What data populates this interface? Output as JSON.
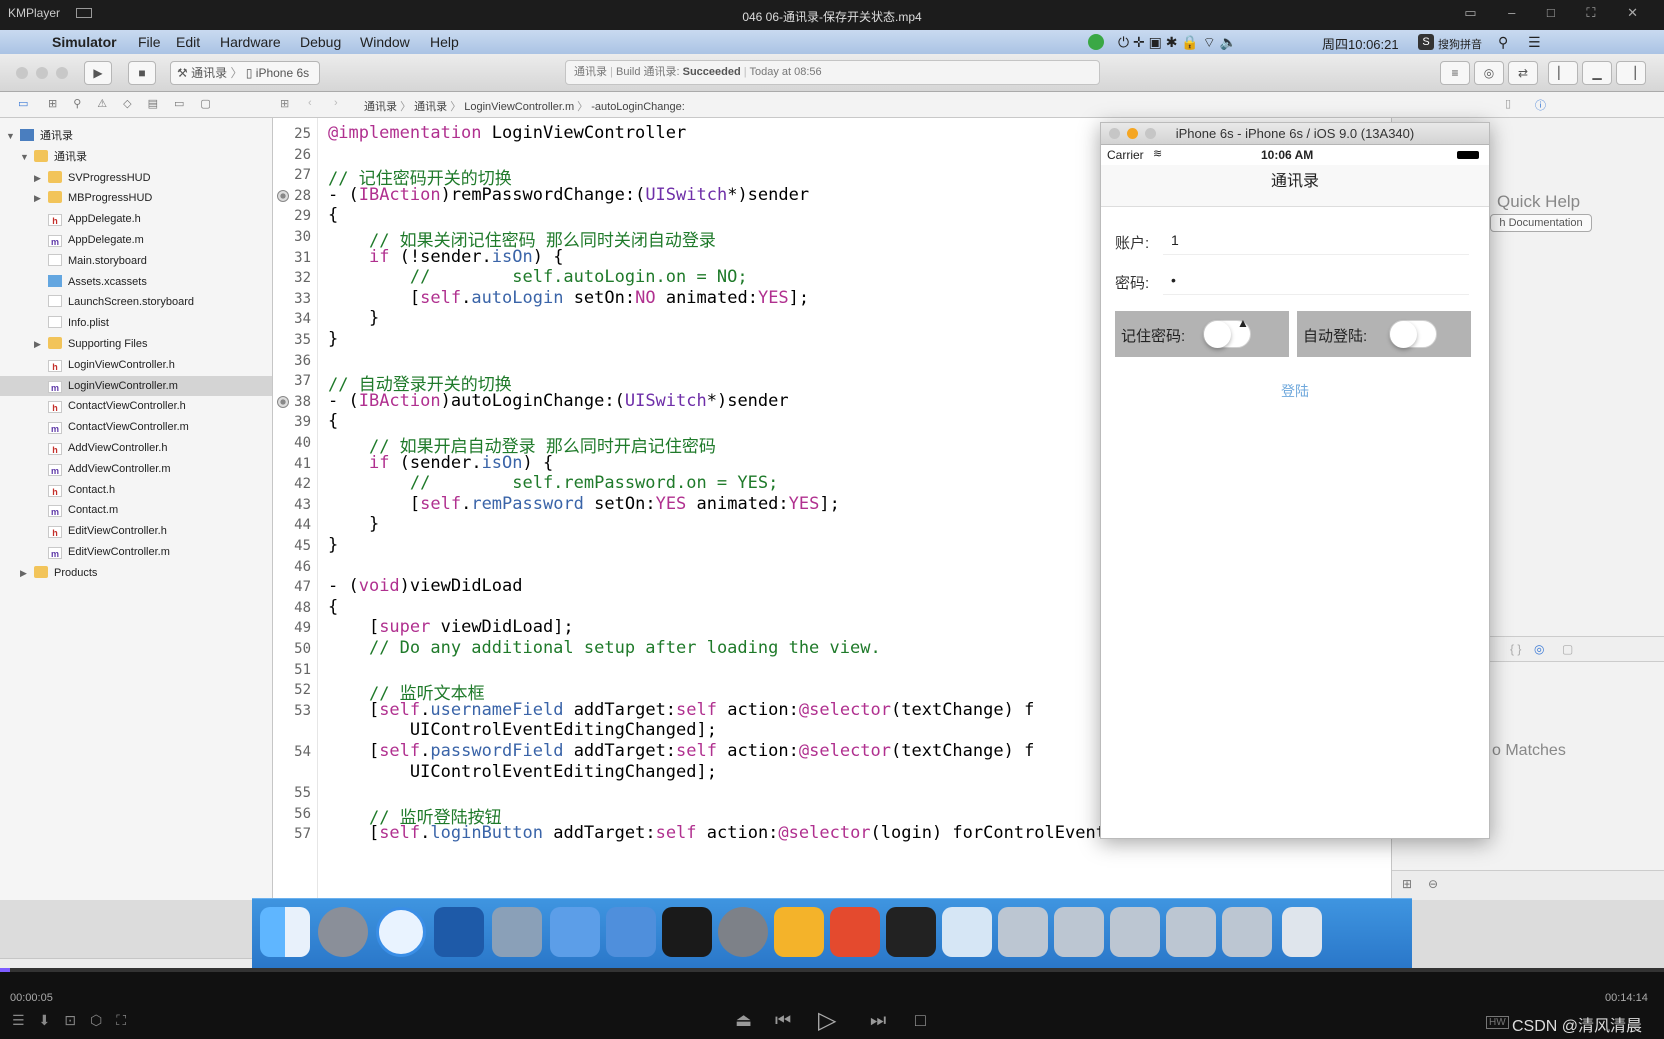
{
  "player": {
    "app_name": "KMPlayer",
    "file_title": "046 06-通讯录-保存开关状态.mp4",
    "time_current": "00:00:05",
    "time_total": "00:14:14",
    "progress": 0.006,
    "watermark": "CSDN @清风清晨"
  },
  "menubar": {
    "app": "Simulator",
    "items": [
      "File",
      "Edit",
      "Hardware",
      "Debug",
      "Window",
      "Help"
    ],
    "clock": "周四10:06:21",
    "input_method": "搜狗拼音"
  },
  "toolbar": {
    "scheme": "通讯录",
    "device": "iPhone 6s",
    "activity_project": "通讯录",
    "activity_build": "Build 通讯录:",
    "activity_status": "Succeeded",
    "activity_time": "Today at 08:56"
  },
  "jumpbar": {
    "crumbs": [
      "通讯录",
      "通讯录",
      "LoginViewController.m",
      "-autoLoginChange:"
    ]
  },
  "navigator": {
    "items": [
      {
        "label": "通讯录",
        "type": "proj",
        "indent": 0,
        "tri": "▼"
      },
      {
        "label": "通讯录",
        "type": "folder",
        "indent": 1,
        "tri": "▼"
      },
      {
        "label": "SVProgressHUD",
        "type": "folder",
        "indent": 2,
        "tri": "▶"
      },
      {
        "label": "MBProgressHUD",
        "type": "folder",
        "indent": 2,
        "tri": "▶"
      },
      {
        "label": "AppDelegate.h",
        "type": "h",
        "indent": 2
      },
      {
        "label": "AppDelegate.m",
        "type": "m",
        "indent": 2
      },
      {
        "label": "Main.storyboard",
        "type": "sb",
        "indent": 2
      },
      {
        "label": "Assets.xcassets",
        "type": "assets",
        "indent": 2
      },
      {
        "label": "LaunchScreen.storyboard",
        "type": "sb",
        "indent": 2
      },
      {
        "label": "Info.plist",
        "type": "plist",
        "indent": 2
      },
      {
        "label": "Supporting Files",
        "type": "folder",
        "indent": 2,
        "tri": "▶"
      },
      {
        "label": "LoginViewController.h",
        "type": "h",
        "indent": 2
      },
      {
        "label": "LoginViewController.m",
        "type": "m",
        "indent": 2,
        "selected": true
      },
      {
        "label": "ContactViewController.h",
        "type": "h",
        "indent": 2
      },
      {
        "label": "ContactViewController.m",
        "type": "m",
        "indent": 2
      },
      {
        "label": "AddViewController.h",
        "type": "h",
        "indent": 2
      },
      {
        "label": "AddViewController.m",
        "type": "m",
        "indent": 2
      },
      {
        "label": "Contact.h",
        "type": "h",
        "indent": 2
      },
      {
        "label": "Contact.m",
        "type": "m",
        "indent": 2
      },
      {
        "label": "EditViewController.h",
        "type": "h",
        "indent": 2
      },
      {
        "label": "EditViewController.m",
        "type": "m",
        "indent": 2
      },
      {
        "label": "Products",
        "type": "folder",
        "indent": 1,
        "tri": "▶"
      }
    ]
  },
  "editor": {
    "lines": [
      {
        "n": "25",
        "html": "<span class=\"kw\">@implementation</span> LoginViewController"
      },
      {
        "n": "26",
        "html": ""
      },
      {
        "n": "27",
        "html": "<span class=\"cm\">// 记住密码开关的切换</span>"
      },
      {
        "n": "28",
        "bp": true,
        "html": "- (<span class=\"kw\">IBAction</span>)remPasswordChange:(<span class=\"ty\">UISwitch</span>*)sender"
      },
      {
        "n": "29",
        "html": "{"
      },
      {
        "n": "30",
        "html": "    <span class=\"cm\">// 如果关闭记住密码 那么同时关闭自动登录</span>"
      },
      {
        "n": "31",
        "html": "    <span class=\"kw\">if</span> (!sender.<span class=\"pr\">isOn</span>) {"
      },
      {
        "n": "32",
        "html": "        <span class=\"cm\">//        self.autoLogin.on = NO;</span>"
      },
      {
        "n": "33",
        "html": "        [<span class=\"kw\">self</span>.<span class=\"pr\">autoLogin</span> setOn:<span class=\"kw\">NO</span> animated:<span class=\"kw\">YES</span>];"
      },
      {
        "n": "34",
        "html": "    }"
      },
      {
        "n": "35",
        "html": "}"
      },
      {
        "n": "36",
        "html": ""
      },
      {
        "n": "37",
        "html": "<span class=\"cm\">// 自动登录开关的切换</span>"
      },
      {
        "n": "38",
        "bp": true,
        "html": "- (<span class=\"kw\">IBAction</span>)autoLoginChange:(<span class=\"ty\">UISwitch</span>*)sender"
      },
      {
        "n": "39",
        "html": "{"
      },
      {
        "n": "40",
        "html": "    <span class=\"cm\">// 如果开启自动登录 那么同时开启记住密码</span>"
      },
      {
        "n": "41",
        "html": "    <span class=\"kw\">if</span> (sender.<span class=\"pr\">isOn</span>) {"
      },
      {
        "n": "42",
        "html": "        <span class=\"cm\">//        self.remPassword.on = YES;</span>"
      },
      {
        "n": "43",
        "html": "        [<span class=\"kw\">self</span>.<span class=\"pr\">remPassword</span> setOn:<span class=\"kw\">YES</span> animated:<span class=\"kw\">YES</span>];"
      },
      {
        "n": "44",
        "html": "    }"
      },
      {
        "n": "45",
        "html": "}"
      },
      {
        "n": "46",
        "html": ""
      },
      {
        "n": "47",
        "html": "- (<span class=\"kw\">void</span>)viewDidLoad"
      },
      {
        "n": "48",
        "html": "{"
      },
      {
        "n": "49",
        "html": "    [<span class=\"kw\">super</span> viewDidLoad];"
      },
      {
        "n": "50",
        "html": "    <span class=\"cm\">// Do any additional setup after loading the view.</span>"
      },
      {
        "n": "51",
        "html": ""
      },
      {
        "n": "52",
        "html": "    <span class=\"cm\">// 监听文本框</span>"
      },
      {
        "n": "53",
        "html": "    [<span class=\"kw\">self</span>.<span class=\"pr\">usernameField</span> addTarget:<span class=\"kw\">self</span> action:<span class=\"kw\">@selector</span>(textChange) f"
      },
      {
        "n": "",
        "html": "        UIControlEventEditingChanged];"
      },
      {
        "n": "54",
        "html": "    [<span class=\"kw\">self</span>.<span class=\"pr\">passwordField</span> addTarget:<span class=\"kw\">self</span> action:<span class=\"kw\">@selector</span>(textChange) f"
      },
      {
        "n": "",
        "html": "        UIControlEventEditingChanged];"
      },
      {
        "n": "55",
        "html": ""
      },
      {
        "n": "56",
        "html": "    <span class=\"cm\">// 监听登陆按钮</span>"
      },
      {
        "n": "57",
        "html": "    [<span class=\"kw\">self</span>.<span class=\"pr\">loginButton</span> addTarget:<span class=\"kw\">self</span> action:<span class=\"kw\">@selector</span>(login) forControlEvents:"
      }
    ]
  },
  "inspector": {
    "quick_help": "Quick Help",
    "search_docs": "h Documentation",
    "no_matches": "o Matches"
  },
  "simulator": {
    "title": "iPhone 6s - iPhone 6s / iOS 9.0 (13A340)",
    "carrier": "Carrier",
    "time": "10:06 AM",
    "nav_title": "通讯录",
    "account_label": "账户:",
    "account_value": "1",
    "password_label": "密码:",
    "password_value": "•",
    "rem_label": "记住密码:",
    "rem_on": false,
    "auto_label": "自动登陆:",
    "auto_on": false,
    "login_button": "登陆"
  }
}
